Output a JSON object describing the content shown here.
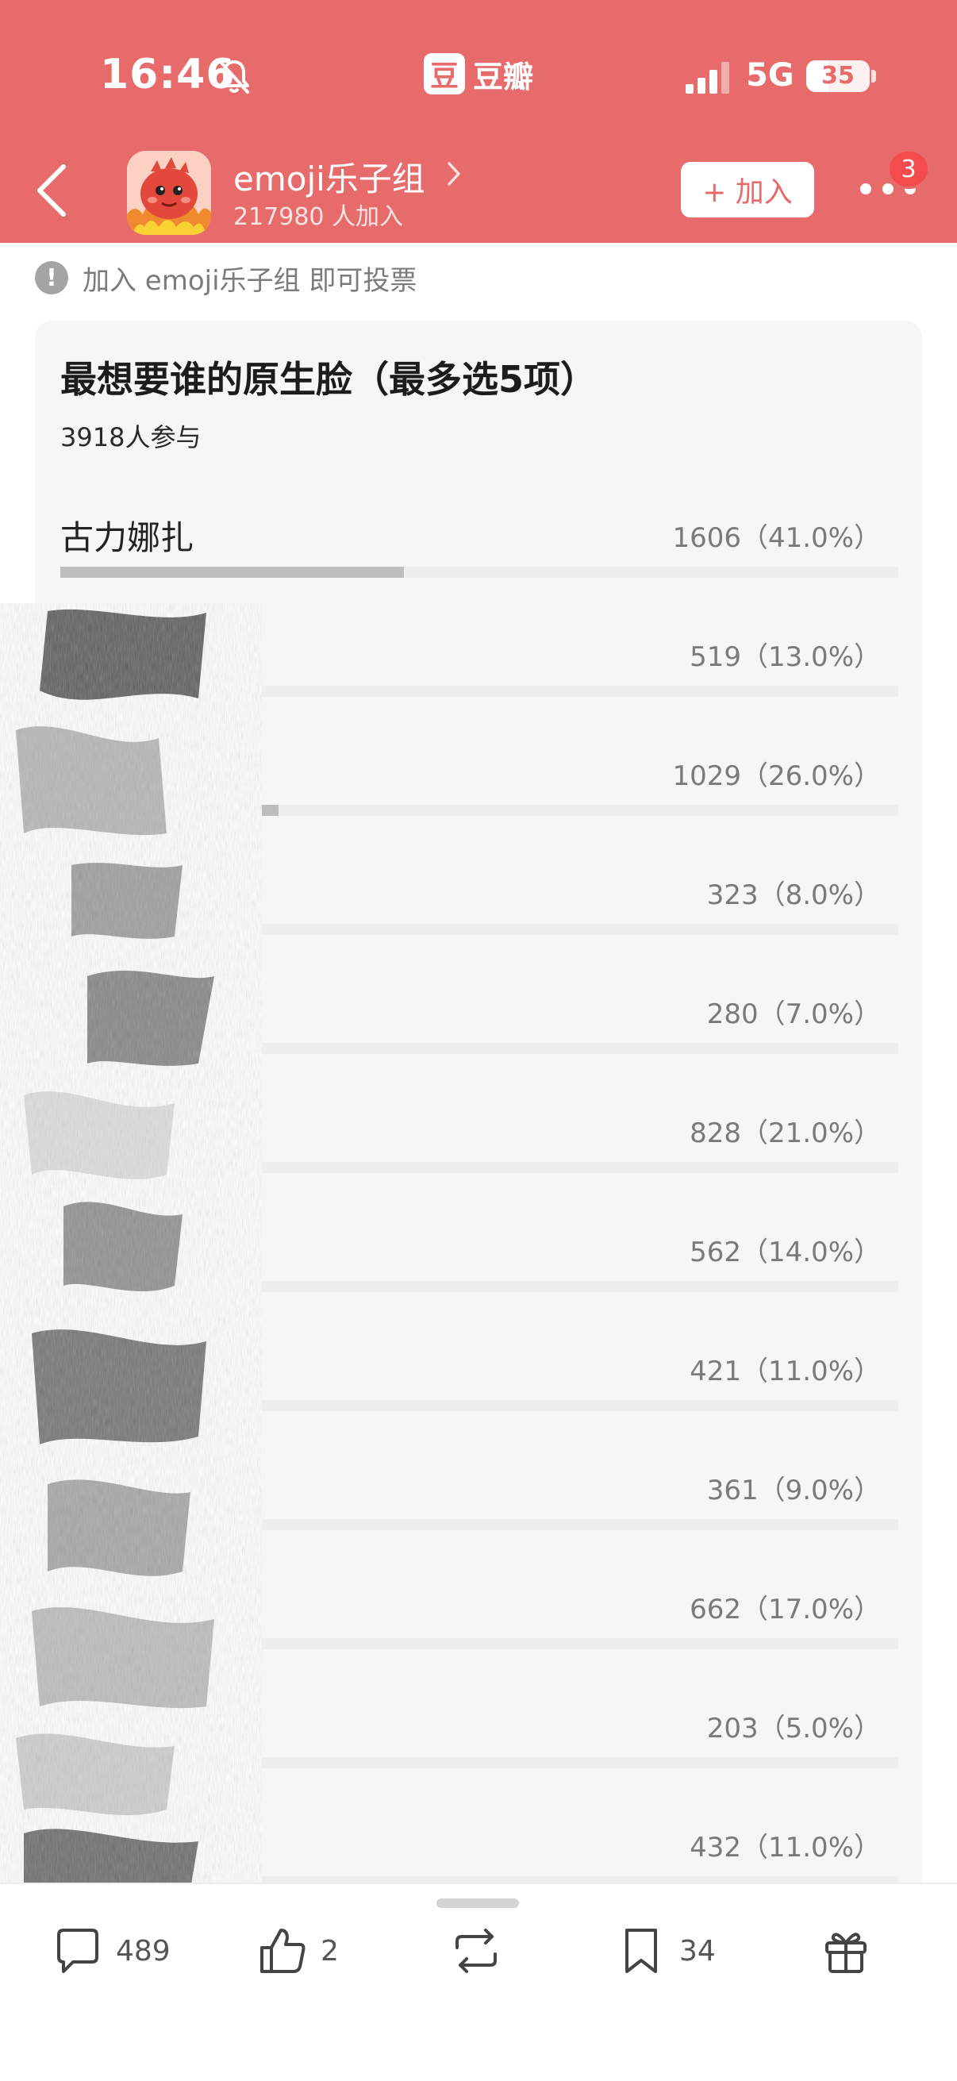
{
  "status_bar": {
    "time": "16:46",
    "app_name": "豆瓣",
    "app_glyph": "豆",
    "network": "5G",
    "battery": "35",
    "battery_level": 0.35
  },
  "group": {
    "name": "emoji乐子组",
    "members": "217980 人加入",
    "join_label": "+ 加入",
    "notification_count": "3"
  },
  "notice": {
    "text": "加入 emoji乐子组 即可投票"
  },
  "poll": {
    "title": "最想要谁的原生脸（最多选5项）",
    "participants": "3918人参与",
    "options": [
      {
        "name": "古力娜扎",
        "count": "1606（41.0%）",
        "percent": 41.0
      },
      {
        "name": "",
        "count": "519（13.0%）",
        "percent": 13.0
      },
      {
        "name": "",
        "count": "1029（26.0%）",
        "percent": 26.0
      },
      {
        "name": "",
        "count": "323（8.0%）",
        "percent": 8.0
      },
      {
        "name": "",
        "count": "280（7.0%）",
        "percent": 7.0
      },
      {
        "name": "",
        "count": "828（21.0%）",
        "percent": 21.0
      },
      {
        "name": "",
        "count": "562（14.0%）",
        "percent": 14.0
      },
      {
        "name": "",
        "count": "421（11.0%）",
        "percent": 11.0
      },
      {
        "name": "",
        "count": "361（9.0%）",
        "percent": 9.0
      },
      {
        "name": "",
        "count": "662（17.0%）",
        "percent": 17.0
      },
      {
        "name": "",
        "count": "203（5.0%）",
        "percent": 5.0
      },
      {
        "name": "",
        "count": "432（11.0%）",
        "percent": 11.0
      }
    ]
  },
  "bottom_bar": {
    "comments": "489",
    "likes": "2",
    "bookmarks": "34",
    "icons": [
      "comment-icon",
      "thumbs-up-icon",
      "repost-icon",
      "bookmark-icon",
      "gift-icon"
    ]
  },
  "colors": {
    "header": "#e86b6b",
    "bar_fill": "#bdbdbd",
    "bar_track": "#eeeeee",
    "card": "#f6f6f6",
    "badge": "#f44c4c"
  }
}
